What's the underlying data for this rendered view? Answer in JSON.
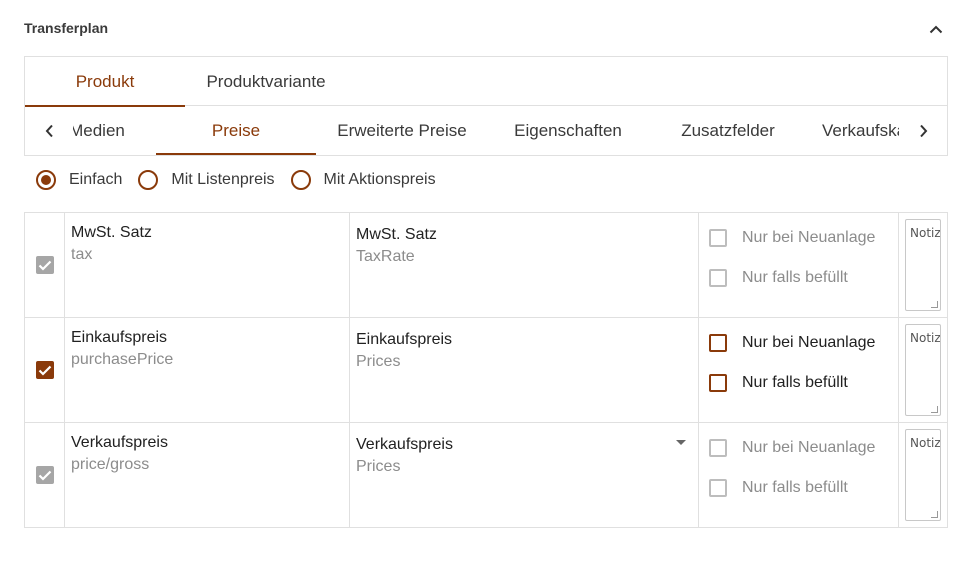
{
  "section": {
    "title": "Transferplan"
  },
  "main_tabs": [
    {
      "label": "Produkt",
      "active": true
    },
    {
      "label": "Produktvariante",
      "active": false
    }
  ],
  "sub_tabs": [
    {
      "label": "Medien",
      "active": false
    },
    {
      "label": "Preise",
      "active": true
    },
    {
      "label": "Erweiterte Preise",
      "active": false
    },
    {
      "label": "Eigenschaften",
      "active": false
    },
    {
      "label": "Zusatzfelder",
      "active": false
    },
    {
      "label": "Verkaufskanäle",
      "active": false
    }
  ],
  "price_mode": {
    "options": [
      {
        "label": "Einfach",
        "selected": true
      },
      {
        "label": "Mit Listenpreis",
        "selected": false
      },
      {
        "label": "Mit Aktionspreis",
        "selected": false
      }
    ]
  },
  "rows": [
    {
      "checked": true,
      "disabled": true,
      "source_label": "MwSt. Satz",
      "source_key": "tax",
      "target_label": "MwSt. Satz",
      "target_key": "TaxRate",
      "has_dropdown": false,
      "only_on_create": {
        "label": "Nur bei Neuanlage",
        "checked": false,
        "disabled": true
      },
      "only_if_filled": {
        "label": "Nur falls befüllt",
        "checked": false,
        "disabled": true
      },
      "note_placeholder": "Notiz"
    },
    {
      "checked": true,
      "disabled": false,
      "source_label": "Einkaufspreis",
      "source_key": "purchasePrice",
      "target_label": "Einkaufspreis",
      "target_key": "Prices",
      "has_dropdown": false,
      "only_on_create": {
        "label": "Nur bei Neuanlage",
        "checked": false,
        "disabled": false
      },
      "only_if_filled": {
        "label": "Nur falls befüllt",
        "checked": false,
        "disabled": false
      },
      "note_placeholder": "Notiz"
    },
    {
      "checked": true,
      "disabled": true,
      "source_label": "Verkaufspreis",
      "source_key": "price/gross",
      "target_label": "Verkaufspreis",
      "target_key": "Prices",
      "has_dropdown": true,
      "only_on_create": {
        "label": "Nur bei Neuanlage",
        "checked": false,
        "disabled": true
      },
      "only_if_filled": {
        "label": "Nur falls befüllt",
        "checked": false,
        "disabled": true
      },
      "note_placeholder": "Notiz"
    }
  ],
  "colors": {
    "accent": "#8a3a0a",
    "disabled": "#a6a6a6",
    "border": "#e0e0e0"
  },
  "icons": {
    "collapse": "chevron-up-icon",
    "scroll_left": "chevron-left-icon",
    "scroll_right": "chevron-right-icon",
    "dropdown": "caret-down-icon",
    "check": "check-icon"
  }
}
